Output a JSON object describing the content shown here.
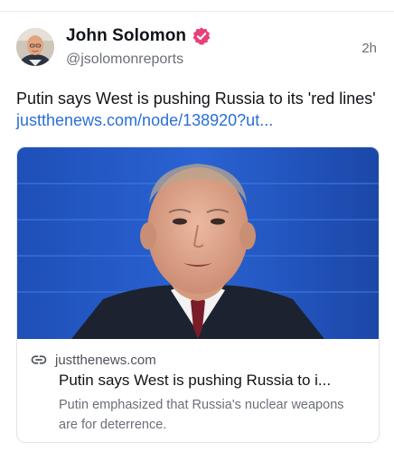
{
  "post": {
    "author_name": "John Solomon",
    "handle": "@jsolomonreports",
    "timestamp": "2h",
    "text": "Putin says West is pushing Russia to its 'red lines'",
    "link_text": "justthenews.com/node/138920?ut..."
  },
  "card": {
    "domain": "justthenews.com",
    "title": "Putin says West is pushing Russia to i...",
    "description": "Putin emphasized that Russia's nuclear weapons are for deterrence."
  },
  "icons": {
    "verified": "verified-badge-icon",
    "link": "link-icon"
  },
  "colors": {
    "link": "#2a6fd6",
    "verified_badge": "#e8407a",
    "muted_text": "#6b6f78"
  }
}
